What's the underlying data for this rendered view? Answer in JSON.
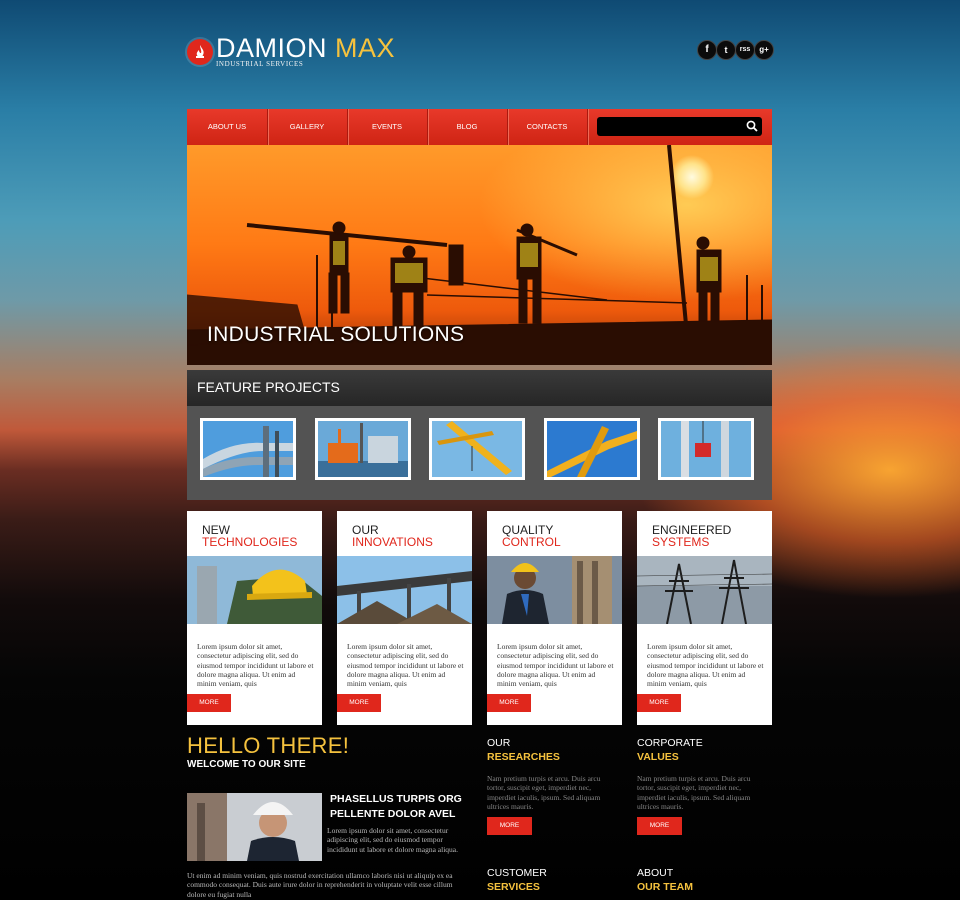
{
  "header": {
    "logo_main": "DAMION",
    "logo_accent": "MAX",
    "logo_sub": "INDUSTRIAL SERVICES",
    "social": [
      "f",
      "t",
      "rss",
      "g+"
    ]
  },
  "nav": {
    "items": [
      "ABOUT US",
      "GALLERY",
      "EVENTS",
      "BLOG",
      "CONTACTS"
    ],
    "search_placeholder": ""
  },
  "hero": {
    "title": "INDUSTRIAL SOLUTIONS"
  },
  "feature": {
    "title": "FEATURE PROJECTS"
  },
  "cards": [
    {
      "line1": "NEW",
      "line2": "TECHNOLOGIES",
      "text": "Lorem ipsum dolor sit amet, consectetur adipiscing elit, sed do eiusmod tempor incididunt ut labore et dolore magna aliqua. Ut enim ad minim veniam, quis",
      "more": "MORE"
    },
    {
      "line1": "OUR",
      "line2": "INNOVATIONS",
      "text": "Lorem ipsum dolor sit amet, consectetur adipiscing elit, sed do eiusmod tempor incididunt ut labore et dolore magna aliqua. Ut enim ad minim veniam, quis",
      "more": "MORE"
    },
    {
      "line1": "QUALITY",
      "line2": "CONTROL",
      "text": "Lorem ipsum dolor sit amet, consectetur adipiscing elit, sed do eiusmod tempor incididunt ut labore et dolore magna aliqua. Ut enim ad minim veniam, quis",
      "more": "MORE"
    },
    {
      "line1": "ENGINEERED",
      "line2": "SYSTEMS",
      "text": "Lorem ipsum dolor sit amet, consectetur adipiscing elit, sed do eiusmod tempor incididunt ut labore et dolore magna aliqua. Ut enim ad minim veniam, quis",
      "more": "MORE"
    }
  ],
  "hello": {
    "title": "HELLO THERE!",
    "subtitle": "WELCOME TO OUR SITE",
    "feature_line1": "PHASELLUS TURPIS ORG",
    "feature_line2": "PELLENTE DOLOR AVEL",
    "feature_text": "Lorem ipsum dolor sit amet, consectetur adipiscing elit, sed do eiusmod tempor incididunt ut labore et dolore magna aliqua.",
    "long_text": "Ut enim ad minim veniam, quis nostrud exercitation ullamco laboris nisi ut aliquip ex ea commodo consequat. Duis aute irure dolor in reprehenderit in voluptate velit esse cillum dolore eu fugiat nulla"
  },
  "columns": [
    {
      "line1": "OUR",
      "line2": "RESEARCHES",
      "text": "Nam pretium turpis et arcu. Duis arcu tortor, suscipit eget, imperdiet nec, imperdiet iaculis, ipsum. Sed aliquam ultrices mauris.",
      "more": "MORE"
    },
    {
      "line1": "CORPORATE",
      "line2": "VALUES",
      "text": "Nam pretium turpis et arcu. Duis arcu tortor, suscipit eget, imperdiet nec, imperdiet iaculis, ipsum. Sed aliquam ultrices mauris.",
      "more": "MORE"
    },
    {
      "line1": "CUSTOMER",
      "line2": "SERVICES"
    },
    {
      "line1": "ABOUT",
      "line2": "OUR TEAM"
    }
  ],
  "colors": {
    "accent_red": "#e0271c",
    "accent_yellow": "#f5c23e"
  }
}
